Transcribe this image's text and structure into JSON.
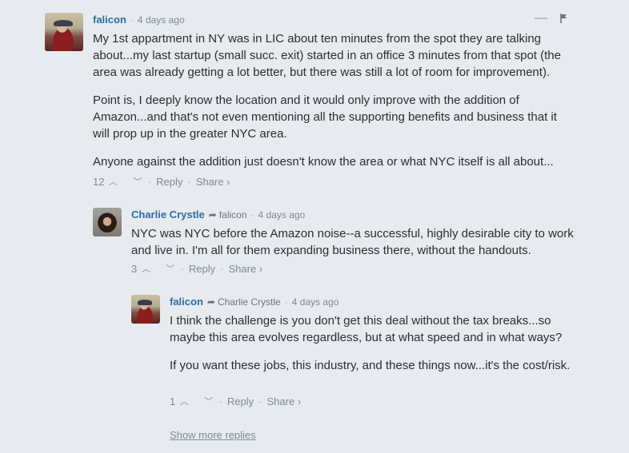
{
  "comments": [
    {
      "author": "falicon",
      "timestamp": "4 days ago",
      "paragraphs": [
        "My 1st appartment in NY was in LIC about ten minutes from the spot they are talking about...my last startup (small succ. exit) started in an office 3 minutes from that spot (the area was already getting a lot better, but there was still a lot of room for improvement).",
        "Point is, I deeply know the location and it would only improve with the addition of Amazon...and that's not even mentioning all the supporting benefits and business that it will prop up in the greater NYC area.",
        "Anyone against the addition just doesn't know the area or what NYC itself is all about..."
      ],
      "votes": "12",
      "reply_label": "Reply",
      "share_label": "Share ›",
      "collapse_icon": "minus-icon",
      "flag_icon": "flag-icon"
    },
    {
      "author": "Charlie Crystle",
      "in_reply_to": "falicon",
      "timestamp": "4 days ago",
      "paragraphs": [
        "NYC was NYC before the Amazon noise--a successful, highly desirable city to work and live in. I'm all for them expanding business there, without the handouts."
      ],
      "votes": "3",
      "reply_label": "Reply",
      "share_label": "Share ›"
    },
    {
      "author": "falicon",
      "in_reply_to": "Charlie Crystle",
      "timestamp": "4 days ago",
      "paragraphs": [
        "I think the challenge is you don't get this deal without the tax breaks...so maybe this area evolves regardless, but at what speed and in what ways?",
        "If you want these jobs, this industry, and these things now...it's the cost/risk."
      ],
      "votes": "1",
      "reply_label": "Reply",
      "share_label": "Share ›"
    }
  ],
  "show_more_label": "Show more replies",
  "separator": "·",
  "upvote_glyph": "︿",
  "downvote_glyph": "﹀",
  "reply_arrow_glyph": "➦"
}
